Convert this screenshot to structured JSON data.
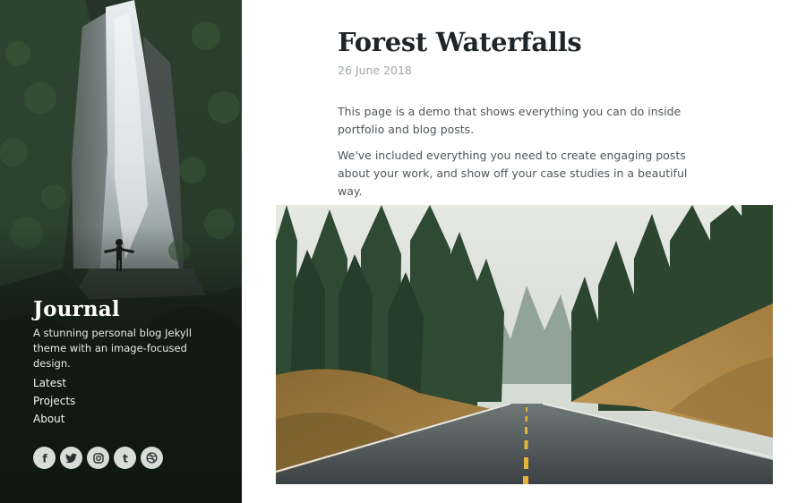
{
  "sidebar": {
    "title": "Journal",
    "description": "A stunning personal blog Jekyll theme with an image-focused design.",
    "nav": [
      {
        "label": "Latest"
      },
      {
        "label": "Projects"
      },
      {
        "label": "About"
      }
    ],
    "socials": [
      {
        "icon": "facebook-icon",
        "glyph": "f"
      },
      {
        "icon": "twitter-icon"
      },
      {
        "icon": "instagram-icon"
      },
      {
        "icon": "tumblr-icon",
        "glyph": "t"
      },
      {
        "icon": "dribbble-icon"
      }
    ],
    "background_image": "waterfall-forest-photo"
  },
  "post": {
    "title": "Forest Waterfalls",
    "date": "26 June 2018",
    "paragraphs": [
      "This page is a demo that shows everything you can do inside portfolio and blog posts.",
      "We've included everything you need to create engaging posts about your work, and show off your case studies in a beautiful way."
    ],
    "hero_image": "forest-road-photo"
  },
  "colors": {
    "title_text": "#1f2528",
    "date_text": "#a2a8ab",
    "body_text": "#4f575b",
    "social_circle": "#d9dcd9"
  }
}
